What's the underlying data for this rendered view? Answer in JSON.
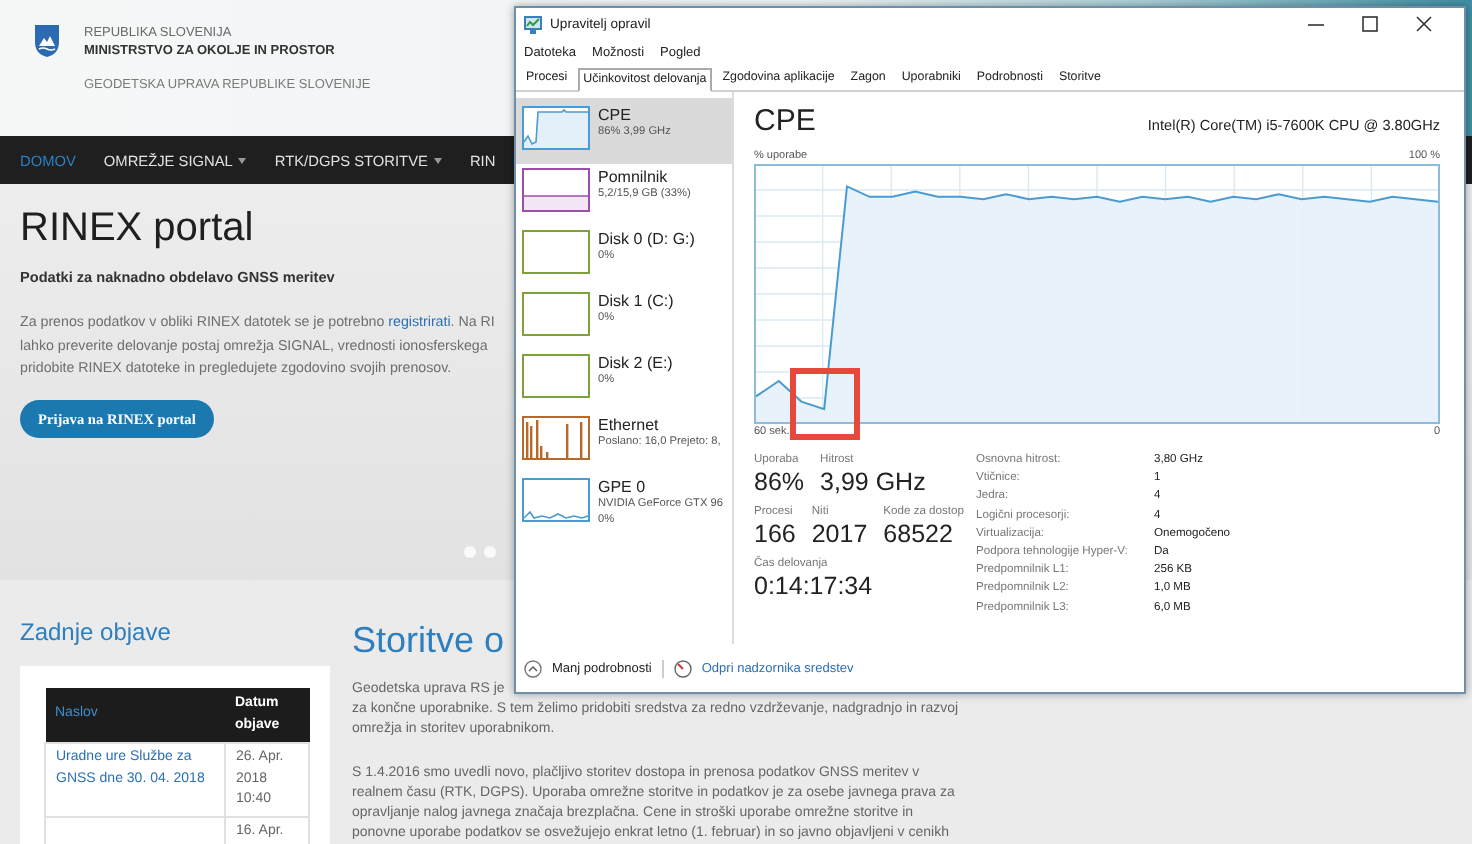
{
  "site": {
    "header": {
      "country": "REPUBLIKA SLOVENIJA",
      "ministry": "MINISTRSTVO ZA OKOLJE IN PROSTOR",
      "agency": "GEODETSKA UPRAVA REPUBLIKE SLOVENIJE"
    },
    "nav": [
      {
        "label": "DOMOV",
        "selected": true,
        "dropdown": false
      },
      {
        "label": "OMREŽJE SIGNAL",
        "selected": false,
        "dropdown": true
      },
      {
        "label": "RTK/DGPS STORITVE",
        "selected": false,
        "dropdown": true
      },
      {
        "label": "RIN",
        "selected": false,
        "dropdown": false
      }
    ],
    "hero": {
      "title": "RINEX portal",
      "subtitle": "Podatki za naknadno obdelavo GNSS meritev",
      "intro": [
        [
          {
            "kind": "text",
            "text": "Za prenos podatkov v obliki RINEX datotek se je potrebno "
          },
          {
            "kind": "link",
            "text": "registrirati"
          },
          {
            "kind": "text",
            "text": ". Na RI"
          }
        ],
        [
          {
            "kind": "text",
            "text": "lahko preverite delovanje postaj omrežja SIGNAL, vrednosti ionosferskega"
          }
        ],
        [
          {
            "kind": "text",
            "text": "pridobite RINEX datoteke in pregledujete zgodovino svojih prenosov."
          }
        ]
      ],
      "button": "Prijava na RINEX portal",
      "carousel_dots": [
        {
          "selected": false
        },
        {
          "selected": false
        }
      ]
    },
    "recent": {
      "title": "Zadnje objave",
      "columns": [
        "Naslov",
        "Datum objave"
      ],
      "rows": [
        {
          "title": "Uradne ure Službe za GNSS dne 30. 04. 2018",
          "date": "26. Apr. 2018 10:40"
        },
        {
          "date": "16. Apr."
        }
      ]
    },
    "services": {
      "title": "Storitve o",
      "paragraphs": [
        [
          "Geodetska uprava RS je",
          "za končne uporabnike. S tem želimo pridobiti sredstva za redno vzdrževanje, nadgradnjo in razvoj",
          "omrežja in storitev uporabnikom."
        ],
        [
          "S 1.4.2016 smo uvedli novo, plačljivo storitev dostopa in prenosa podatkov GNSS meritev v",
          "realnem času (RTK, DGPS). Uporaba omrežne storitve in podatkov je za osebe javnega prava za",
          "opravljanje nalog javnega značaja brezplačna.  Cene in stroški uporabe omrežne storitve in",
          "ponovne uporabe podatkov se osvežujejo enkrat letno (1. februar) in so javno objavljeni v cenikh"
        ]
      ]
    }
  },
  "task_manager": {
    "title": "Upravitelj opravil",
    "menu": [
      "Datoteka",
      "Možnosti",
      "Pogled"
    ],
    "tabs": [
      {
        "label": "Procesi",
        "selected": false
      },
      {
        "label": "Učinkovitost delovanja",
        "selected": true
      },
      {
        "label": "Zgodovina aplikacije",
        "selected": false
      },
      {
        "label": "Zagon",
        "selected": false
      },
      {
        "label": "Uporabniki",
        "selected": false
      },
      {
        "label": "Podrobnosti",
        "selected": false
      },
      {
        "label": "Storitve",
        "selected": false
      }
    ],
    "resources": [
      {
        "kind": "cpu",
        "name": "CPE",
        "details": [
          "86% 3,99 GHz"
        ],
        "color": "#4a9bd1",
        "selected": true
      },
      {
        "kind": "memory",
        "name": "Pomnilnik",
        "details": [
          "5,2/15,9 GB (33%)"
        ],
        "color": "#9b4fab",
        "selected": false
      },
      {
        "kind": "disk",
        "name": "Disk 0 (D: G:)",
        "details": [
          "0%"
        ],
        "color": "#7fa33a",
        "selected": false
      },
      {
        "kind": "disk",
        "name": "Disk 1 (C:)",
        "details": [
          "0%"
        ],
        "color": "#7fa33a",
        "selected": false
      },
      {
        "kind": "disk",
        "name": "Disk 2 (E:)",
        "details": [
          "0%"
        ],
        "color": "#7fa33a",
        "selected": false
      },
      {
        "kind": "ethernet",
        "name": "Ethernet",
        "details": [
          "Poslano: 16,0 Prejeto: 8,"
        ],
        "color": "#b8692a",
        "selected": false
      },
      {
        "kind": "gpu",
        "name": "GPE 0",
        "details": [
          "NVIDIA GeForce GTX 96",
          "0%"
        ],
        "color": "#4a9bd1",
        "selected": false
      }
    ],
    "panel": {
      "title": "CPE",
      "model": "Intel(R) Core(TM) i5-7600K CPU @ 3.80GHz",
      "graph": {
        "caption": "% uporabe",
        "max_label": "100 %",
        "start_label": "60 sek.",
        "end_label": "0"
      },
      "annotation": {
        "kind": "rectangle"
      },
      "stats": [
        [
          {
            "label": "Uporaba",
            "value": "86%"
          },
          {
            "label": "Hitrost",
            "value": "3,99 GHz"
          }
        ],
        [
          {
            "label": "Procesi",
            "value": "166"
          },
          {
            "label": "Niti",
            "value": "2017"
          },
          {
            "label": "Kode za dostop",
            "value": "68522"
          }
        ],
        [
          {
            "label": "Čas delovanja",
            "value": "0:14:17:34"
          }
        ]
      ],
      "specs": [
        {
          "label": "Osnovna hitrost:",
          "value": "3,80 GHz"
        },
        {
          "label": "Vtičnice:",
          "value": "1"
        },
        {
          "label": "Jedra:",
          "value": "4"
        },
        {
          "label": "Logični procesorji:",
          "value": "4"
        },
        {
          "label": "Virtualizacija:",
          "value": "Onemogočeno"
        },
        {
          "label": "Podpora tehnologije Hyper-V:",
          "value": "Da"
        },
        {
          "label": "Predpomnilnik L1:",
          "value": "256 KB"
        },
        {
          "label": "Predpomnilnik L2:",
          "value": "1,0 MB"
        },
        {
          "label": "Predpomnilnik L3:",
          "value": "6,0 MB"
        }
      ]
    },
    "footer": {
      "less_details": "Manj podrobnosti",
      "resource_monitor": "Odpri nadzornika sredstev"
    }
  }
}
